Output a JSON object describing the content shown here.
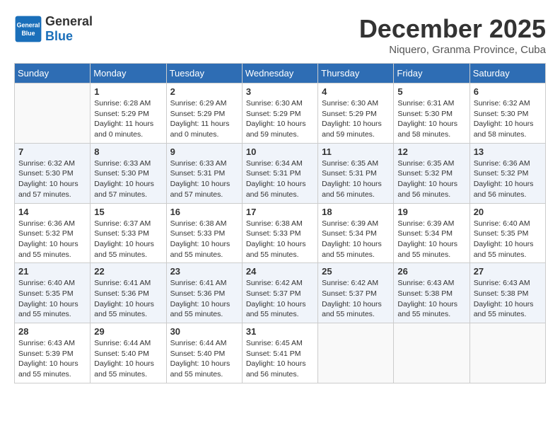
{
  "header": {
    "logo_general": "General",
    "logo_blue": "Blue",
    "month_title": "December 2025",
    "location": "Niquero, Granma Province, Cuba"
  },
  "days_of_week": [
    "Sunday",
    "Monday",
    "Tuesday",
    "Wednesday",
    "Thursday",
    "Friday",
    "Saturday"
  ],
  "weeks": [
    [
      {
        "day": "",
        "sunrise": "",
        "sunset": "",
        "daylight": ""
      },
      {
        "day": "1",
        "sunrise": "Sunrise: 6:28 AM",
        "sunset": "Sunset: 5:29 PM",
        "daylight": "Daylight: 11 hours and 0 minutes."
      },
      {
        "day": "2",
        "sunrise": "Sunrise: 6:29 AM",
        "sunset": "Sunset: 5:29 PM",
        "daylight": "Daylight: 11 hours and 0 minutes."
      },
      {
        "day": "3",
        "sunrise": "Sunrise: 6:30 AM",
        "sunset": "Sunset: 5:29 PM",
        "daylight": "Daylight: 10 hours and 59 minutes."
      },
      {
        "day": "4",
        "sunrise": "Sunrise: 6:30 AM",
        "sunset": "Sunset: 5:29 PM",
        "daylight": "Daylight: 10 hours and 59 minutes."
      },
      {
        "day": "5",
        "sunrise": "Sunrise: 6:31 AM",
        "sunset": "Sunset: 5:30 PM",
        "daylight": "Daylight: 10 hours and 58 minutes."
      },
      {
        "day": "6",
        "sunrise": "Sunrise: 6:32 AM",
        "sunset": "Sunset: 5:30 PM",
        "daylight": "Daylight: 10 hours and 58 minutes."
      }
    ],
    [
      {
        "day": "7",
        "sunrise": "Sunrise: 6:32 AM",
        "sunset": "Sunset: 5:30 PM",
        "daylight": "Daylight: 10 hours and 57 minutes."
      },
      {
        "day": "8",
        "sunrise": "Sunrise: 6:33 AM",
        "sunset": "Sunset: 5:30 PM",
        "daylight": "Daylight: 10 hours and 57 minutes."
      },
      {
        "day": "9",
        "sunrise": "Sunrise: 6:33 AM",
        "sunset": "Sunset: 5:31 PM",
        "daylight": "Daylight: 10 hours and 57 minutes."
      },
      {
        "day": "10",
        "sunrise": "Sunrise: 6:34 AM",
        "sunset": "Sunset: 5:31 PM",
        "daylight": "Daylight: 10 hours and 56 minutes."
      },
      {
        "day": "11",
        "sunrise": "Sunrise: 6:35 AM",
        "sunset": "Sunset: 5:31 PM",
        "daylight": "Daylight: 10 hours and 56 minutes."
      },
      {
        "day": "12",
        "sunrise": "Sunrise: 6:35 AM",
        "sunset": "Sunset: 5:32 PM",
        "daylight": "Daylight: 10 hours and 56 minutes."
      },
      {
        "day": "13",
        "sunrise": "Sunrise: 6:36 AM",
        "sunset": "Sunset: 5:32 PM",
        "daylight": "Daylight: 10 hours and 56 minutes."
      }
    ],
    [
      {
        "day": "14",
        "sunrise": "Sunrise: 6:36 AM",
        "sunset": "Sunset: 5:32 PM",
        "daylight": "Daylight: 10 hours and 55 minutes."
      },
      {
        "day": "15",
        "sunrise": "Sunrise: 6:37 AM",
        "sunset": "Sunset: 5:33 PM",
        "daylight": "Daylight: 10 hours and 55 minutes."
      },
      {
        "day": "16",
        "sunrise": "Sunrise: 6:38 AM",
        "sunset": "Sunset: 5:33 PM",
        "daylight": "Daylight: 10 hours and 55 minutes."
      },
      {
        "day": "17",
        "sunrise": "Sunrise: 6:38 AM",
        "sunset": "Sunset: 5:33 PM",
        "daylight": "Daylight: 10 hours and 55 minutes."
      },
      {
        "day": "18",
        "sunrise": "Sunrise: 6:39 AM",
        "sunset": "Sunset: 5:34 PM",
        "daylight": "Daylight: 10 hours and 55 minutes."
      },
      {
        "day": "19",
        "sunrise": "Sunrise: 6:39 AM",
        "sunset": "Sunset: 5:34 PM",
        "daylight": "Daylight: 10 hours and 55 minutes."
      },
      {
        "day": "20",
        "sunrise": "Sunrise: 6:40 AM",
        "sunset": "Sunset: 5:35 PM",
        "daylight": "Daylight: 10 hours and 55 minutes."
      }
    ],
    [
      {
        "day": "21",
        "sunrise": "Sunrise: 6:40 AM",
        "sunset": "Sunset: 5:35 PM",
        "daylight": "Daylight: 10 hours and 55 minutes."
      },
      {
        "day": "22",
        "sunrise": "Sunrise: 6:41 AM",
        "sunset": "Sunset: 5:36 PM",
        "daylight": "Daylight: 10 hours and 55 minutes."
      },
      {
        "day": "23",
        "sunrise": "Sunrise: 6:41 AM",
        "sunset": "Sunset: 5:36 PM",
        "daylight": "Daylight: 10 hours and 55 minutes."
      },
      {
        "day": "24",
        "sunrise": "Sunrise: 6:42 AM",
        "sunset": "Sunset: 5:37 PM",
        "daylight": "Daylight: 10 hours and 55 minutes."
      },
      {
        "day": "25",
        "sunrise": "Sunrise: 6:42 AM",
        "sunset": "Sunset: 5:37 PM",
        "daylight": "Daylight: 10 hours and 55 minutes."
      },
      {
        "day": "26",
        "sunrise": "Sunrise: 6:43 AM",
        "sunset": "Sunset: 5:38 PM",
        "daylight": "Daylight: 10 hours and 55 minutes."
      },
      {
        "day": "27",
        "sunrise": "Sunrise: 6:43 AM",
        "sunset": "Sunset: 5:38 PM",
        "daylight": "Daylight: 10 hours and 55 minutes."
      }
    ],
    [
      {
        "day": "28",
        "sunrise": "Sunrise: 6:43 AM",
        "sunset": "Sunset: 5:39 PM",
        "daylight": "Daylight: 10 hours and 55 minutes."
      },
      {
        "day": "29",
        "sunrise": "Sunrise: 6:44 AM",
        "sunset": "Sunset: 5:40 PM",
        "daylight": "Daylight: 10 hours and 55 minutes."
      },
      {
        "day": "30",
        "sunrise": "Sunrise: 6:44 AM",
        "sunset": "Sunset: 5:40 PM",
        "daylight": "Daylight: 10 hours and 55 minutes."
      },
      {
        "day": "31",
        "sunrise": "Sunrise: 6:45 AM",
        "sunset": "Sunset: 5:41 PM",
        "daylight": "Daylight: 10 hours and 56 minutes."
      },
      {
        "day": "",
        "sunrise": "",
        "sunset": "",
        "daylight": ""
      },
      {
        "day": "",
        "sunrise": "",
        "sunset": "",
        "daylight": ""
      },
      {
        "day": "",
        "sunrise": "",
        "sunset": "",
        "daylight": ""
      }
    ]
  ]
}
